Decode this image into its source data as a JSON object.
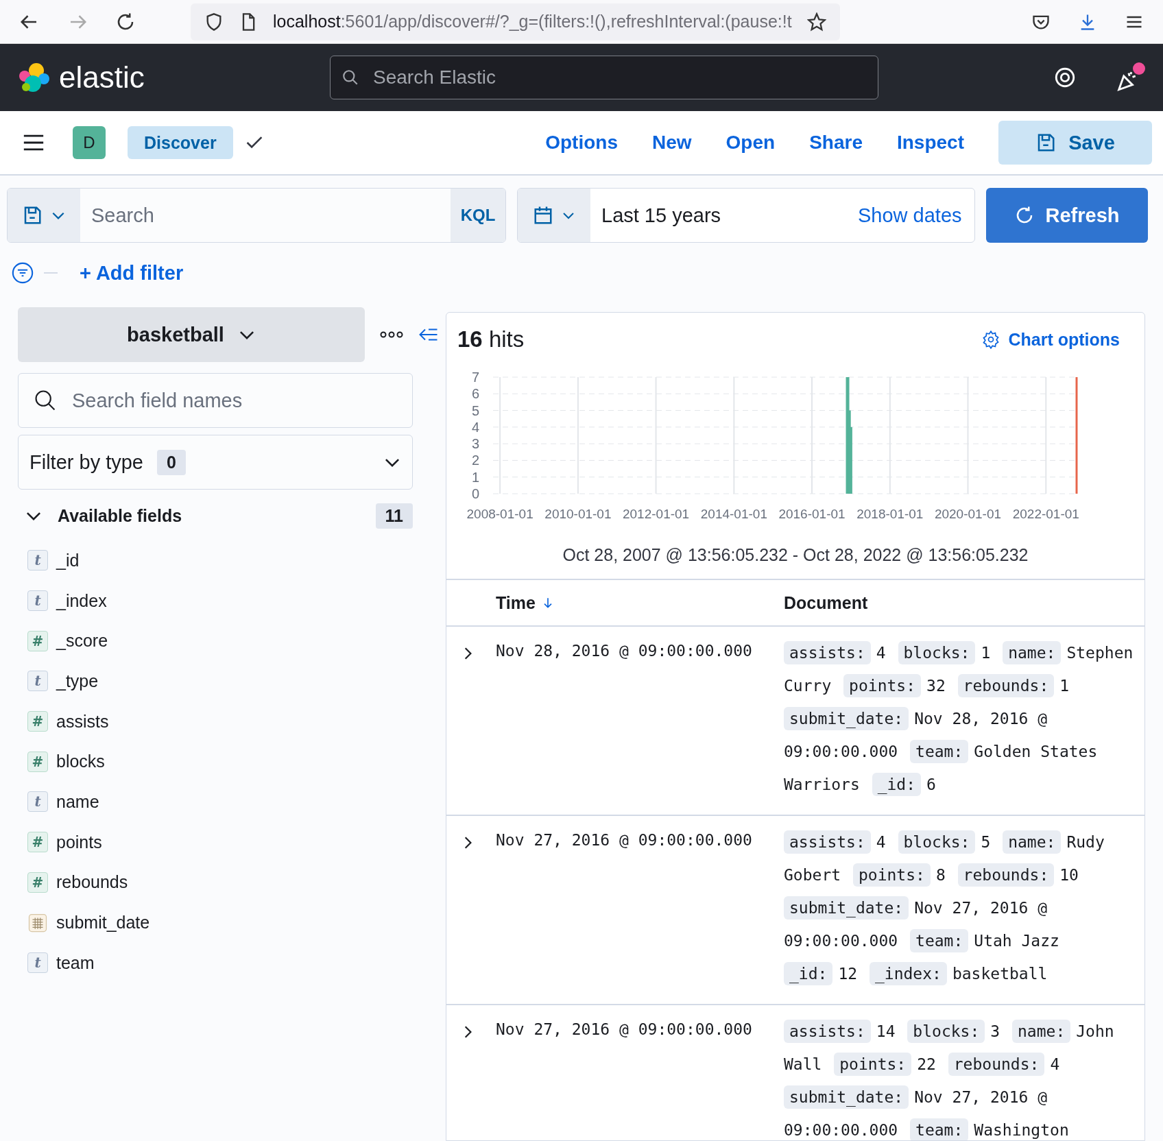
{
  "browser": {
    "url_host": "localhost",
    "url_rest": ":5601/app/discover#/?_g=(filters:!(),refreshInterval:(pause:!t"
  },
  "header": {
    "logo_text": "elastic",
    "search": {
      "placeholder": "Search Elastic"
    },
    "notification": true
  },
  "nav": {
    "avatar": "D",
    "app": "Discover",
    "links": [
      "Options",
      "New",
      "Open",
      "Share",
      "Inspect"
    ],
    "save": "Save"
  },
  "query": {
    "placeholder": "Search",
    "language": "KQL",
    "time_range": "Last 15 years",
    "show_dates": "Show dates",
    "refresh": "Refresh"
  },
  "filters": {
    "add": "+ Add filter"
  },
  "sidebar": {
    "index": "basketball",
    "search": {
      "placeholder": "Search field names"
    },
    "filter_type": {
      "label": "Filter by type",
      "count": "0"
    },
    "available": {
      "label": "Available fields",
      "count": "11",
      "expanded": true
    },
    "fields": [
      {
        "name": "_id",
        "kind": "string",
        "token": "t"
      },
      {
        "name": "_index",
        "kind": "string",
        "token": "t"
      },
      {
        "name": "_score",
        "kind": "number",
        "token": "#"
      },
      {
        "name": "_type",
        "kind": "string",
        "token": "t"
      },
      {
        "name": "assists",
        "kind": "number",
        "token": "#"
      },
      {
        "name": "blocks",
        "kind": "number",
        "token": "#"
      },
      {
        "name": "name",
        "kind": "string",
        "token": "t"
      },
      {
        "name": "points",
        "kind": "number",
        "token": "#"
      },
      {
        "name": "rebounds",
        "kind": "number",
        "token": "#"
      },
      {
        "name": "submit_date",
        "kind": "date"
      },
      {
        "name": "team",
        "kind": "string",
        "token": "t"
      }
    ]
  },
  "results": {
    "hits_count": "16",
    "hits_label": "hits",
    "chart_options": "Chart options",
    "chart_data": {
      "type": "bar",
      "x": [
        "2016-11-14",
        "2016-11-28",
        "2016-12-12"
      ],
      "values": [
        7,
        5,
        4
      ],
      "xlim": [
        "2007-10-28",
        "2022-10-28"
      ],
      "ylim": [
        0,
        7
      ],
      "xticks": [
        "2008-01-01",
        "2010-01-01",
        "2012-01-01",
        "2014-01-01",
        "2016-01-01",
        "2018-01-01",
        "2020-01-01",
        "2022-01-01"
      ],
      "yticks": [
        0,
        1,
        2,
        3,
        4,
        5,
        6,
        7
      ],
      "grid": true
    },
    "range": "Oct 28, 2007 @ 13:56:05.232 - Oct 28, 2022 @ 13:56:05.232",
    "columns": [
      {
        "label": "Time",
        "sorted_descending": true
      },
      {
        "label": "Document"
      }
    ],
    "rows": [
      {
        "expanded": false,
        "time": "Nov 28, 2016 @ 09:00:00.000",
        "fields": [
          {
            "key": "assists:",
            "value": "4"
          },
          {
            "key": "blocks:",
            "value": "1"
          },
          {
            "key": "name:",
            "value": "Stephen Curry"
          },
          {
            "key": "points:",
            "value": "32"
          },
          {
            "key": "rebounds:",
            "value": "1"
          },
          {
            "key": "submit_date:",
            "value": "Nov 28, 2016 @ 09:00:00.000"
          },
          {
            "key": "team:",
            "value": "Golden States Warriors"
          },
          {
            "key": "_id:",
            "value": "6"
          }
        ]
      },
      {
        "expanded": false,
        "time": "Nov 27, 2016 @ 09:00:00.000",
        "fields": [
          {
            "key": "assists:",
            "value": "4"
          },
          {
            "key": "blocks:",
            "value": "5"
          },
          {
            "key": "name:",
            "value": "Rudy Gobert"
          },
          {
            "key": "points:",
            "value": "8"
          },
          {
            "key": "rebounds:",
            "value": "10"
          },
          {
            "key": "submit_date:",
            "value": "Nov 27, 2016 @ 09:00:00.000"
          },
          {
            "key": "team:",
            "value": "Utah Jazz"
          },
          {
            "key": "_id:",
            "value": "12"
          },
          {
            "key": "_index:",
            "value": "basketball"
          }
        ]
      },
      {
        "expanded": false,
        "time": "Nov 27, 2016 @ 09:00:00.000",
        "fields": [
          {
            "key": "assists:",
            "value": "14"
          },
          {
            "key": "blocks:",
            "value": "3"
          },
          {
            "key": "name:",
            "value": "John Wall"
          },
          {
            "key": "points:",
            "value": "22"
          },
          {
            "key": "rebounds:",
            "value": "4"
          },
          {
            "key": "submit_date:",
            "value": "Nov 27, 2016 @ 09:00:00.000"
          },
          {
            "key": "team:",
            "value": "Washington"
          }
        ]
      }
    ]
  }
}
